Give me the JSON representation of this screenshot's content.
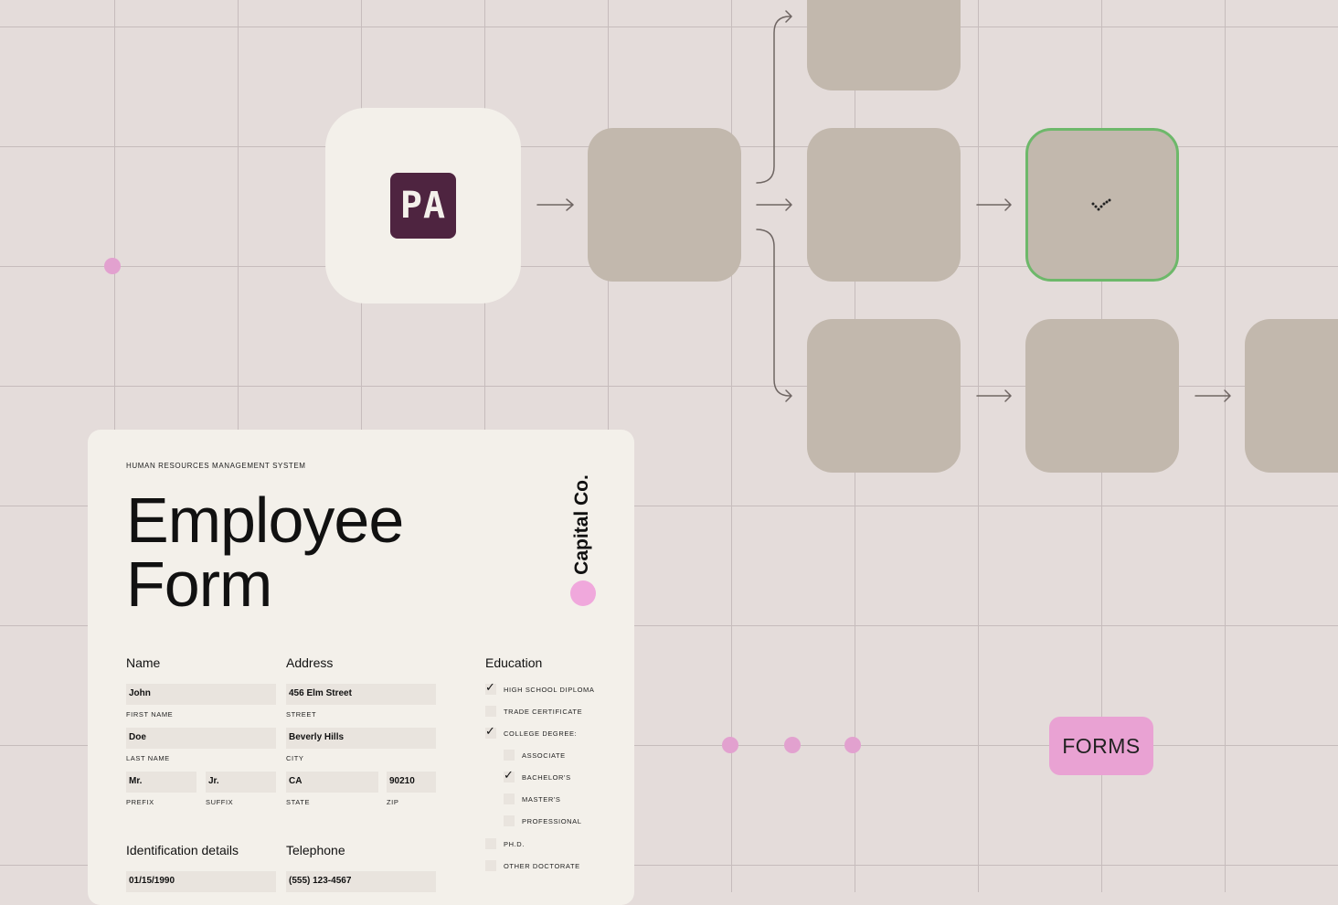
{
  "app_logo": {
    "text": "PA"
  },
  "badge": {
    "text": "FORMS"
  },
  "form": {
    "system_label": "HUMAN RESOURCES MANAGEMENT SYSTEM",
    "title_line1": "Employee",
    "title_line2": "Form",
    "brand": "Capital Co.",
    "sections": {
      "name": "Name",
      "address": "Address",
      "education": "Education",
      "identification": "Identification details",
      "telephone": "Telephone"
    },
    "fields": {
      "first_name": {
        "value": "John",
        "label": "FIRST NAME"
      },
      "last_name": {
        "value": "Doe",
        "label": "LAST NAME"
      },
      "prefix": {
        "value": "Mr.",
        "label": "PREFIX"
      },
      "suffix": {
        "value": "Jr.",
        "label": "SUFFIX"
      },
      "street": {
        "value": "456 Elm Street",
        "label": "STREET"
      },
      "city": {
        "value": "Beverly Hills",
        "label": "CITY"
      },
      "state": {
        "value": "CA",
        "label": "STATE"
      },
      "zip": {
        "value": "90210",
        "label": "ZIP"
      },
      "dob": {
        "value": "01/15/1990"
      },
      "phone": {
        "value": "(555) 123-4567"
      }
    },
    "education": {
      "high_school": {
        "label": "HIGH SCHOOL DIPLOMA",
        "checked": true
      },
      "trade": {
        "label": "TRADE CERTIFICATE",
        "checked": false
      },
      "college": {
        "label": "COLLEGE DEGREE:",
        "checked": true
      },
      "associate": {
        "label": "ASSOCIATE",
        "checked": false
      },
      "bachelors": {
        "label": "BACHELOR'S",
        "checked": true
      },
      "masters": {
        "label": "MASTER'S",
        "checked": false
      },
      "professional": {
        "label": "PROFESSIONAL",
        "checked": false
      },
      "phd": {
        "label": "PH.D.",
        "checked": false
      },
      "other_doctorate": {
        "label": "OTHER DOCTORATE",
        "checked": false
      }
    },
    "check_glyph": "✓"
  },
  "colors": {
    "background": "#e4dcda",
    "node": "#c2b8ad",
    "node_selected_border": "#6db86a",
    "logo": "#4e2440",
    "accent_pink": "#e9a2d3",
    "card": "#f3f0ea"
  },
  "icons": [
    "check-icon",
    "arrow-right-icon"
  ]
}
